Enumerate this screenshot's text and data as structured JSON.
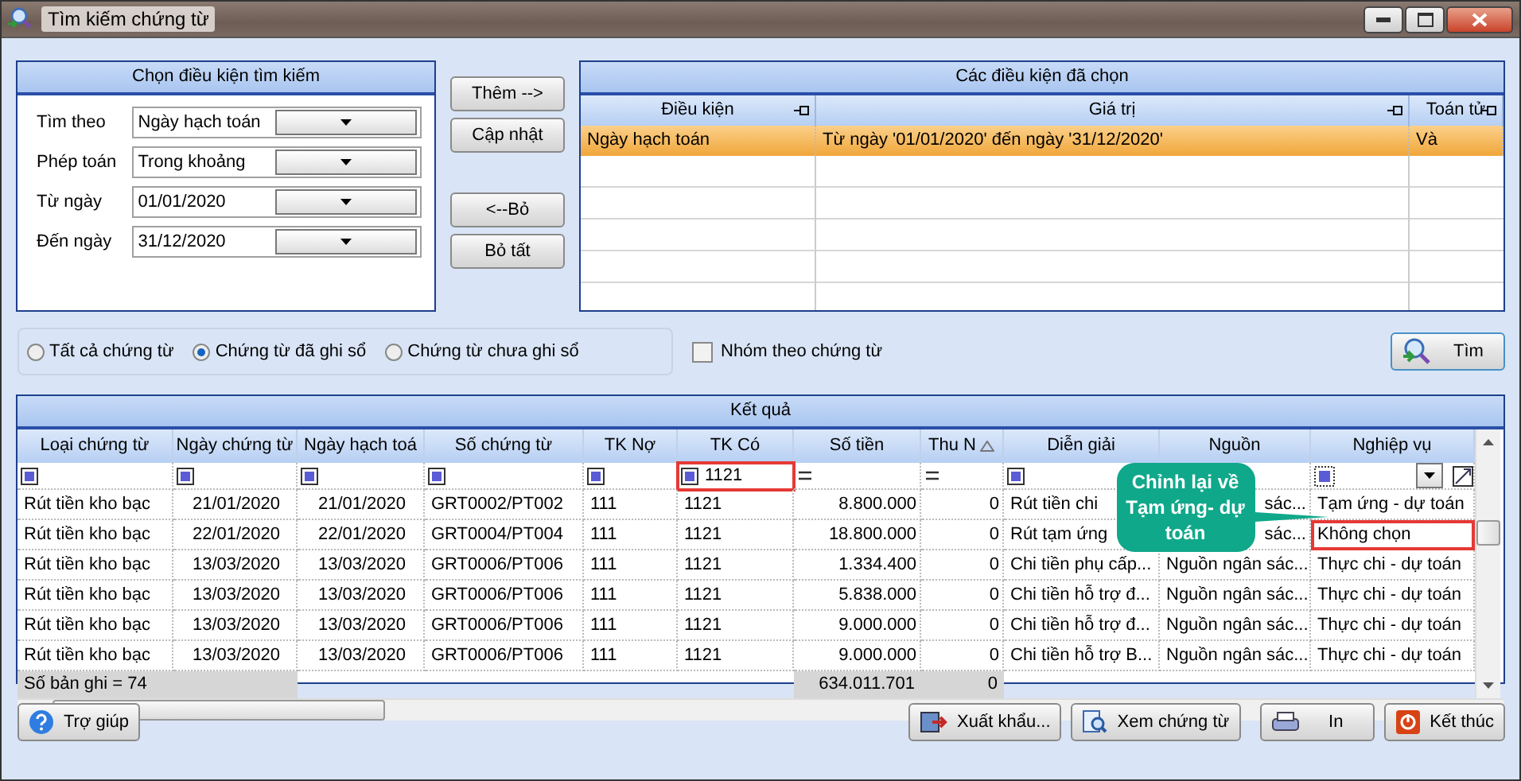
{
  "window": {
    "title": "Tìm kiếm chứng từ"
  },
  "criteria_panel": {
    "title": "Chọn điều kiện tìm kiếm",
    "fields": [
      {
        "label": "Tìm theo",
        "value": "Ngày hạch toán"
      },
      {
        "label": "Phép toán",
        "value": "Trong khoảng"
      },
      {
        "label": "Từ ngày",
        "value": "01/01/2020"
      },
      {
        "label": "Đến ngày",
        "value": "31/12/2020"
      }
    ]
  },
  "action_buttons": [
    "Thêm -->",
    "Cập nhật",
    "<--Bỏ",
    "Bỏ tất"
  ],
  "selected_conditions": {
    "title": "Các điều kiện đã chọn",
    "columns": [
      "Điều kiện",
      "Giá trị",
      "Toán tử"
    ],
    "rows": [
      {
        "cells": [
          "Ngày hạch toán",
          "Từ ngày '01/01/2020' đến ngày '31/12/2020'",
          "Và"
        ],
        "selected": true
      }
    ]
  },
  "radios": [
    {
      "label": "Tất cả chứng từ",
      "selected": false
    },
    {
      "label": "Chứng từ đã ghi sổ",
      "selected": true
    },
    {
      "label": "Chứng từ chưa ghi sổ",
      "selected": false
    }
  ],
  "group_checkbox": {
    "label": "Nhóm theo chứng từ",
    "checked": false
  },
  "search_button": {
    "label": "Tìm"
  },
  "results": {
    "title": "Kết quả",
    "columns": [
      {
        "label": "Loại chứng từ",
        "sorted": false
      },
      {
        "label": "Ngày chứng từ",
        "sorted": false
      },
      {
        "label": "Ngày hạch toá",
        "sorted": false
      },
      {
        "label": "Số chứng từ",
        "sorted": false
      },
      {
        "label": "TK Nợ",
        "sorted": false
      },
      {
        "label": "TK Có",
        "sorted": false
      },
      {
        "label": "Số tiền",
        "sorted": false
      },
      {
        "label": "Thu N",
        "sorted": true
      },
      {
        "label": "Diễn giải",
        "sorted": false
      },
      {
        "label": "Nguồn",
        "sorted": false
      },
      {
        "label": "Nghiệp vụ",
        "sorted": false
      }
    ],
    "filters": [
      {
        "kind": "checkbox",
        "highlighted": false
      },
      {
        "kind": "checkbox",
        "highlighted": false
      },
      {
        "kind": "checkbox",
        "highlighted": false
      },
      {
        "kind": "checkbox",
        "highlighted": false
      },
      {
        "kind": "checkbox",
        "highlighted": false
      },
      {
        "kind": "checkbox",
        "value": "1121",
        "highlighted": true
      },
      {
        "kind": "equals",
        "highlighted": false
      },
      {
        "kind": "equals",
        "highlighted": false
      },
      {
        "kind": "checkbox",
        "highlighted": false
      },
      {
        "kind": "none",
        "highlighted": false
      },
      {
        "kind": "dropdown",
        "highlighted": false
      }
    ],
    "rows": [
      {
        "cells": [
          "Rút tiền kho bạc",
          "21/01/2020",
          "21/01/2020",
          "GRT0002/PT002",
          "111",
          "1121",
          "8.800.000",
          "0",
          "Rút tiền chi",
          "sác...",
          "Tạm ứng - dự toán"
        ],
        "nghiep_vu_highlighted": false
      },
      {
        "cells": [
          "Rút tiền kho bạc",
          "22/01/2020",
          "22/01/2020",
          "GRT0004/PT004",
          "111",
          "1121",
          "18.800.000",
          "0",
          "Rút tạm ứng",
          "sác...",
          "Không chọn"
        ],
        "nghiep_vu_highlighted": true
      },
      {
        "cells": [
          "Rút tiền kho bạc",
          "13/03/2020",
          "13/03/2020",
          "GRT0006/PT006",
          "111",
          "1121",
          "1.334.400",
          "0",
          "Chi tiền phụ cấp...",
          "Nguồn ngân sác...",
          "Thực chi - dự toán"
        ],
        "nghiep_vu_highlighted": false
      },
      {
        "cells": [
          "Rút tiền kho bạc",
          "13/03/2020",
          "13/03/2020",
          "GRT0006/PT006",
          "111",
          "1121",
          "5.838.000",
          "0",
          "Chi tiền hỗ trợ đ...",
          "Nguồn ngân sác...",
          "Thực chi - dự toán"
        ],
        "nghiep_vu_highlighted": false
      },
      {
        "cells": [
          "Rút tiền kho bạc",
          "13/03/2020",
          "13/03/2020",
          "GRT0006/PT006",
          "111",
          "1121",
          "9.000.000",
          "0",
          "Chi tiền hỗ trợ đ...",
          "Nguồn ngân sác...",
          "Thực chi - dự toán"
        ],
        "nghiep_vu_highlighted": false
      },
      {
        "cells": [
          "Rút tiền kho bạc",
          "13/03/2020",
          "13/03/2020",
          "GRT0006/PT006",
          "111",
          "1121",
          "9.000.000",
          "0",
          "Chi tiền hỗ trợ B...",
          "Nguồn ngân sác...",
          "Thực chi - dự toán"
        ],
        "nghiep_vu_highlighted": false
      }
    ],
    "footer": {
      "count": "Số bản ghi = 74",
      "total": "634.011.701",
      "thu_n": "0"
    },
    "callout": {
      "text": "Chỉnh lại về Tạm ứng- dự toán"
    }
  },
  "help_button": {
    "label": "Trợ giúp"
  },
  "bottom_buttons": [
    {
      "label": "Xuất khẩu...",
      "kind": "export"
    },
    {
      "label": "Xem chứng từ",
      "kind": "view"
    },
    {
      "label": "In",
      "kind": "print"
    },
    {
      "label": "Kết thúc",
      "kind": "exit"
    }
  ]
}
